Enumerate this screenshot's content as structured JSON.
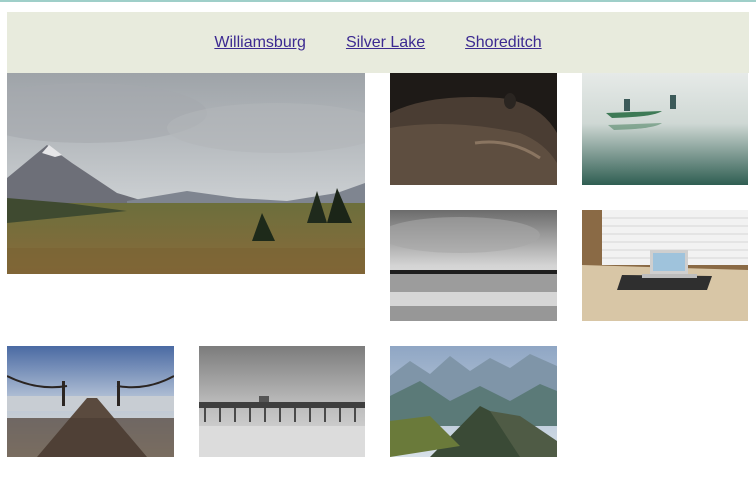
{
  "nav": {
    "links": [
      "Williamsburg",
      "Silver Lake",
      "Shoreditch"
    ]
  },
  "gallery": {
    "photos": [
      {
        "subject": "mountain-valley-landscape"
      },
      {
        "subject": "vintage-car-hood"
      },
      {
        "subject": "canoe-on-misty-lake"
      },
      {
        "subject": "black-and-white-beach"
      },
      {
        "subject": "laptop-on-desk-by-window"
      },
      {
        "subject": "wooden-pier-at-sunset"
      },
      {
        "subject": "foggy-pier"
      },
      {
        "subject": "rocky-mountain-peaks"
      }
    ]
  }
}
